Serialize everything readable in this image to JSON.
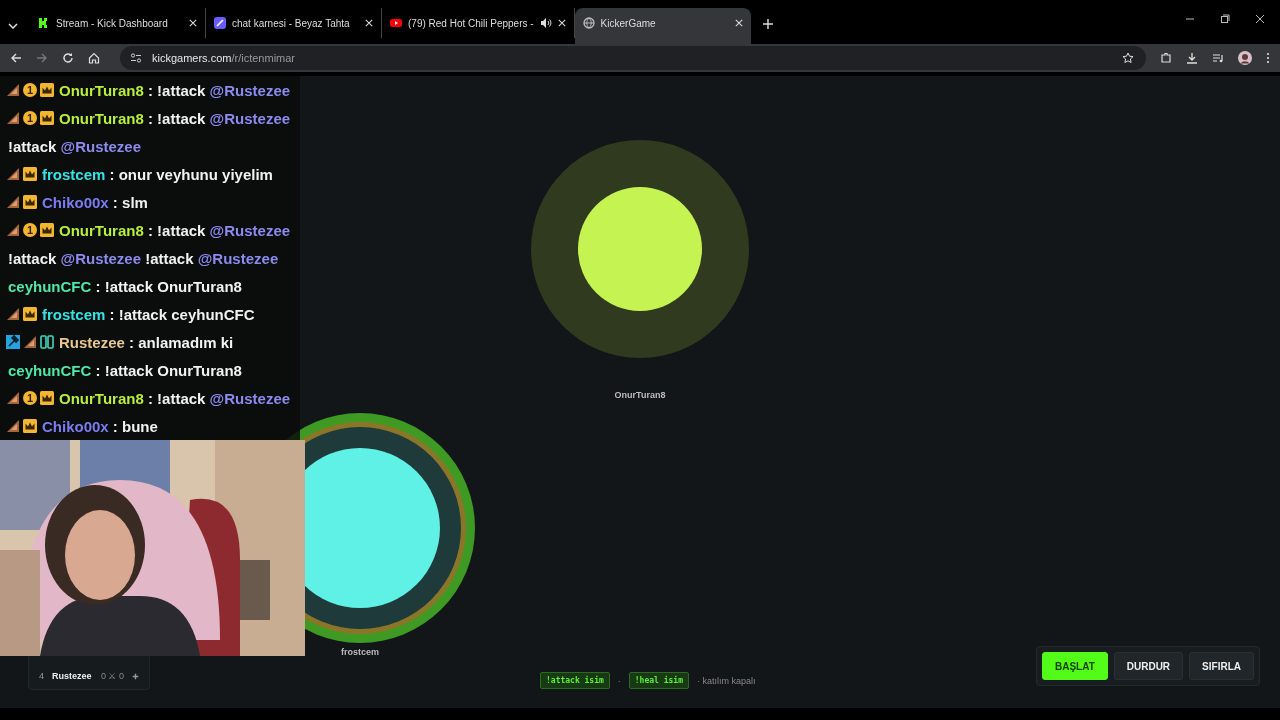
{
  "tabs": [
    {
      "title": "Stream - Kick Dashboard",
      "kind": "kick",
      "selected": false,
      "audio": false
    },
    {
      "title": "chat karnesi - Beyaz Tahta",
      "kind": "board",
      "selected": false,
      "audio": false
    },
    {
      "title": "(79) Red Hot Chili Peppers -",
      "kind": "video",
      "selected": false,
      "audio": true
    },
    {
      "title": "KickerGame",
      "kind": "globe",
      "selected": true,
      "audio": false
    }
  ],
  "address": {
    "host": "kickgamers.com",
    "path": "/r/ictenmimar"
  },
  "chat": [
    {
      "badges": [
        {
          "kind": "sub"
        },
        {
          "kind": "gift",
          "label": "1"
        },
        {
          "kind": "crown"
        }
      ],
      "user": "OnurTuran8",
      "separator": ":",
      "color": "#b8f03c",
      "parts": [
        {
          "kind": "plain",
          "text": "!attack"
        },
        {
          "kind": "mention",
          "text": "@Rustezee"
        }
      ]
    },
    {
      "badges": [
        {
          "kind": "sub"
        },
        {
          "kind": "gift",
          "label": "1"
        },
        {
          "kind": "crown"
        }
      ],
      "user": "OnurTuran8",
      "separator": ":",
      "color": "#b8f03c",
      "parts": [
        {
          "kind": "plain",
          "text": "!attack"
        },
        {
          "kind": "mention",
          "text": "@Rustezee"
        }
      ]
    },
    {
      "parts": [
        {
          "kind": "plain",
          "text": "!attack"
        },
        {
          "kind": "mention",
          "text": "@Rustezee"
        }
      ]
    },
    {
      "badges": [
        {
          "kind": "sub"
        },
        {
          "kind": "crown"
        }
      ],
      "user": "frostcem",
      "separator": ":",
      "color": "#35e3e3",
      "parts": [
        {
          "kind": "plain",
          "text": "onur veyhunu yiyelim"
        }
      ]
    },
    {
      "badges": [
        {
          "kind": "sub"
        },
        {
          "kind": "crown"
        }
      ],
      "user": "Chiko00x",
      "separator": ":",
      "color": "#7b7cf0",
      "parts": [
        {
          "kind": "plain",
          "text": "slm"
        }
      ]
    },
    {
      "badges": [
        {
          "kind": "sub"
        },
        {
          "kind": "gift",
          "label": "1"
        },
        {
          "kind": "crown"
        }
      ],
      "user": "OnurTuran8",
      "separator": ":",
      "color": "#b8f03c",
      "parts": [
        {
          "kind": "plain",
          "text": "!attack"
        },
        {
          "kind": "mention",
          "text": "@Rustezee"
        }
      ]
    },
    {
      "parts": [
        {
          "kind": "plain",
          "text": "!attack"
        },
        {
          "kind": "mention",
          "text": "@Rustezee"
        },
        {
          "kind": "plain",
          "text": "!attack"
        },
        {
          "kind": "mention",
          "text": "@Rustezee"
        }
      ]
    },
    {
      "user": "ceyhunCFC",
      "separator": ":",
      "color": "#4fe8a8",
      "parts": [
        {
          "kind": "plain",
          "text": "!attack OnurTuran8"
        }
      ]
    },
    {
      "badges": [
        {
          "kind": "sub"
        },
        {
          "kind": "crown"
        }
      ],
      "user": "frostcem",
      "separator": ":",
      "color": "#35e3e3",
      "parts": [
        {
          "kind": "plain",
          "text": "!attack ceyhunCFC"
        }
      ]
    },
    {
      "badges": [
        {
          "kind": "mod"
        },
        {
          "kind": "sub"
        },
        {
          "kind": "og"
        }
      ],
      "user": "Rustezee",
      "separator": ":",
      "color": "#e8c890",
      "parts": [
        {
          "kind": "plain",
          "text": "anlamadım ki"
        }
      ]
    },
    {
      "user": "ceyhunCFC",
      "separator": ":",
      "color": "#4fe8a8",
      "parts": [
        {
          "kind": "plain",
          "text": "!attack OnurTuran8"
        }
      ]
    },
    {
      "badges": [
        {
          "kind": "sub"
        },
        {
          "kind": "gift",
          "label": "1"
        },
        {
          "kind": "crown"
        }
      ],
      "user": "OnurTuran8",
      "separator": ":",
      "color": "#b8f03c",
      "parts": [
        {
          "kind": "plain",
          "text": "!attack"
        },
        {
          "kind": "mention",
          "text": "@Rustezee"
        }
      ]
    },
    {
      "badges": [
        {
          "kind": "sub"
        },
        {
          "kind": "crown"
        }
      ],
      "user": "Chiko00x",
      "separator": ":",
      "color": "#7b7cf0",
      "parts": [
        {
          "kind": "plain",
          "text": "bune"
        }
      ]
    }
  ],
  "players": [
    {
      "name": "OnurTuran8",
      "kind": "large",
      "color": "#c4f352"
    },
    {
      "name": "frostcem",
      "kind": "ringed",
      "color": "#5ff0e6"
    }
  ],
  "leaderboard": [
    {
      "rank": "4",
      "name": "Rustezee",
      "score": "0 ⚔ 0"
    }
  ],
  "commands": [
    {
      "text": "!attack isim"
    },
    {
      "text": "!heal isim"
    }
  ],
  "command_separator": "·",
  "join_status": "· katılım kapalı",
  "buttons": [
    {
      "label": "BAŞLAT",
      "primary": true
    },
    {
      "label": "DURDUR",
      "primary": false
    },
    {
      "label": "SIFIRLA",
      "primary": false
    }
  ]
}
